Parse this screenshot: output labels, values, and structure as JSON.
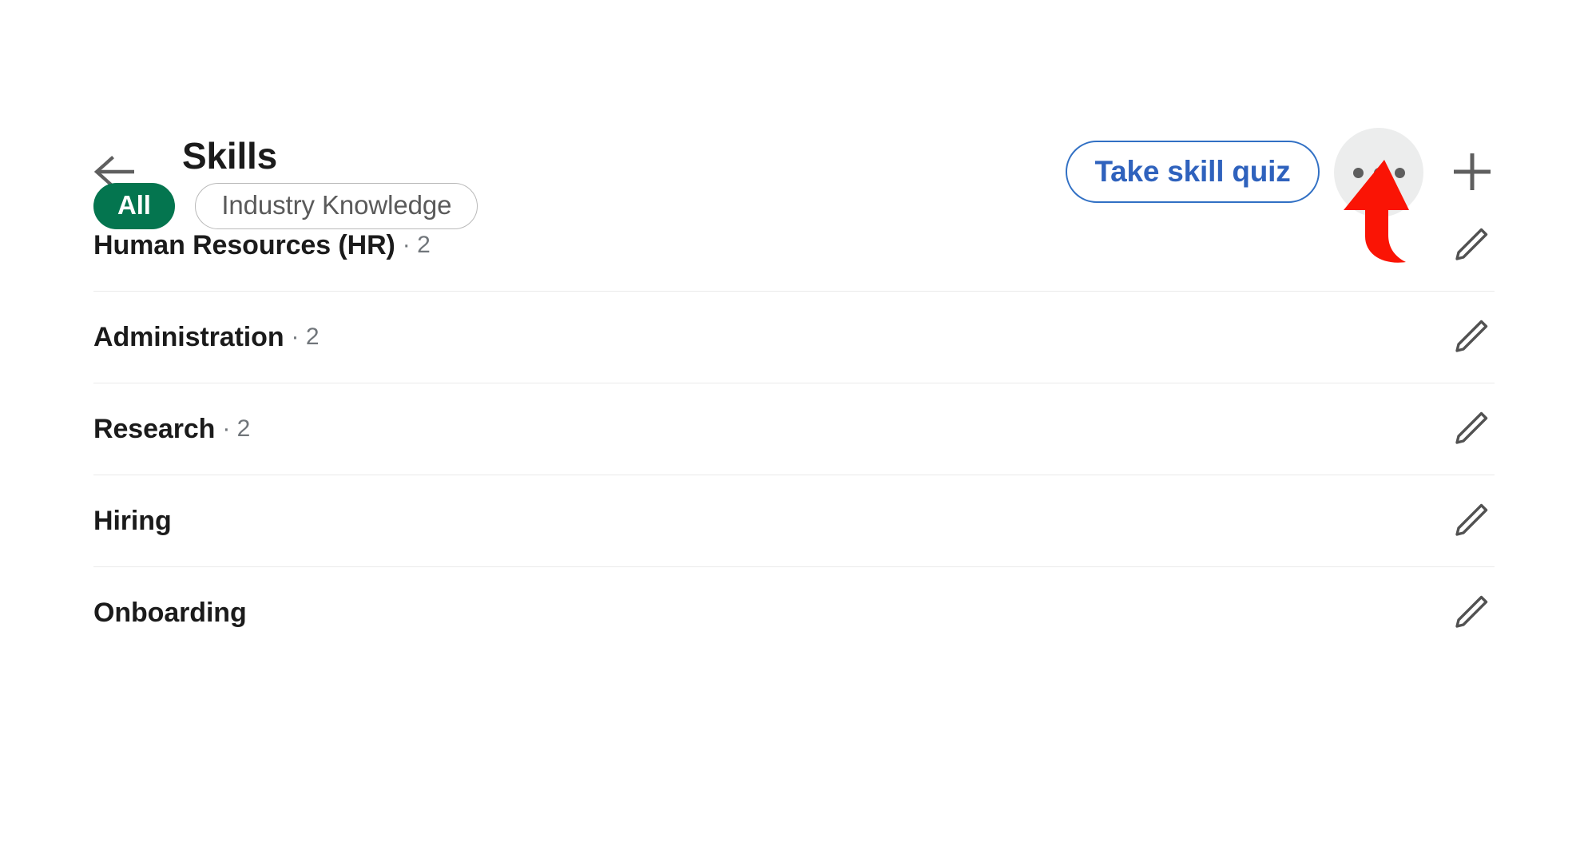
{
  "header": {
    "back_icon": "back-arrow-icon",
    "title": "Skills",
    "quiz_button_label": "Take skill quiz",
    "more_icon": "ellipsis-icon",
    "add_icon": "plus-icon"
  },
  "filters": [
    {
      "label": "All",
      "selected": true
    },
    {
      "label": "Industry Knowledge",
      "selected": false
    }
  ],
  "skills": [
    {
      "name": "Human Resources (HR)",
      "count": "· 2",
      "edit_icon": "pencil-icon"
    },
    {
      "name": "Administration",
      "count": "· 2",
      "edit_icon": "pencil-icon"
    },
    {
      "name": "Research",
      "count": "· 2",
      "edit_icon": "pencil-icon"
    },
    {
      "name": "Hiring",
      "count": "",
      "edit_icon": "pencil-icon"
    },
    {
      "name": "Onboarding",
      "count": "",
      "edit_icon": "pencil-icon"
    }
  ],
  "annotation": {
    "type": "curved-up-arrow",
    "color": "#fa1405",
    "points_to": "more-options-button"
  },
  "colors": {
    "accent_blue": "#2f62bd",
    "brand_green": "#04754f",
    "text_primary": "#1b1b1b",
    "text_secondary": "#70757a",
    "divider": "#eaeaea",
    "hover_gray": "#eceded",
    "annotation_red": "#fa1405"
  }
}
